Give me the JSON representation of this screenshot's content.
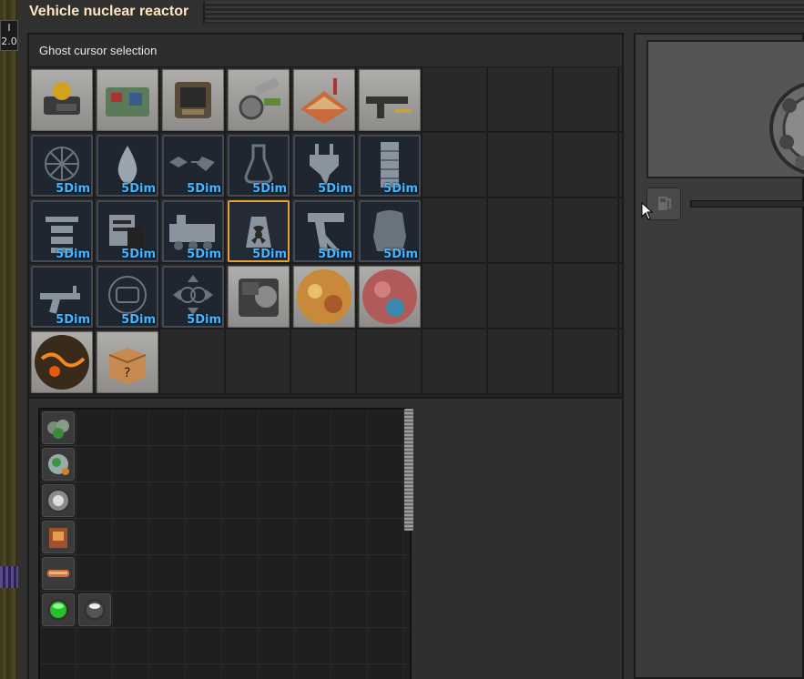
{
  "window": {
    "title": "Vehicle nuclear reactor"
  },
  "hud": {
    "line1": "I",
    "line2": "2.0"
  },
  "ghost_panel": {
    "header": "Ghost cursor selection"
  },
  "tabs": [
    {
      "id": "logistics",
      "icon": "logistics-icon",
      "badge": ""
    },
    {
      "id": "production",
      "icon": "production-icon",
      "badge": ""
    },
    {
      "id": "intermediate",
      "icon": "intermediate-products-icon",
      "badge": ""
    },
    {
      "id": "combat-materials",
      "icon": "gears-icon",
      "badge": ""
    },
    {
      "id": "space",
      "icon": "space-platform-icon",
      "badge": ""
    },
    {
      "id": "combat",
      "icon": "submachine-gun-icon",
      "badge": ""
    },
    {
      "id": "5dim-mining",
      "icon": "mining-drill-icon",
      "badge": "5Dim"
    },
    {
      "id": "5dim-fluids",
      "icon": "fluid-drop-icon",
      "badge": "5Dim"
    },
    {
      "id": "5dim-transport",
      "icon": "transport-arrow-icon",
      "badge": "5Dim"
    },
    {
      "id": "5dim-science",
      "icon": "flask-icon",
      "badge": "5Dim"
    },
    {
      "id": "5dim-energy",
      "icon": "power-plug-icon",
      "badge": "5Dim"
    },
    {
      "id": "5dim-walls",
      "icon": "wall-icon",
      "badge": "5Dim"
    },
    {
      "id": "5dim-robots",
      "icon": "drone-icon",
      "badge": "5Dim"
    },
    {
      "id": "5dim-storage",
      "icon": "storage-tower-icon",
      "badge": "5Dim"
    },
    {
      "id": "5dim-trains",
      "icon": "locomotive-icon",
      "badge": "5Dim"
    },
    {
      "id": "5dim-nuclear",
      "icon": "nuclear-icon",
      "badge": "5Dim",
      "selected": true
    },
    {
      "id": "5dim-turrets",
      "icon": "turret-icon",
      "badge": "5Dim"
    },
    {
      "id": "5dim-armor",
      "icon": "armor-icon",
      "badge": "5Dim"
    },
    {
      "id": "5dim-weapons",
      "icon": "rifle-icon",
      "badge": "5Dim"
    },
    {
      "id": "5dim-engine",
      "icon": "engine-icon",
      "badge": "5Dim"
    },
    {
      "id": "5dim-modules",
      "icon": "module-icon",
      "badge": "5Dim"
    },
    {
      "id": "vehicles",
      "icon": "vehicle-equipment-icon",
      "badge": ""
    },
    {
      "id": "planet-vulcanus",
      "icon": "planet-vulcanus-icon",
      "badge": ""
    },
    {
      "id": "planet-gleba",
      "icon": "planet-gleba-icon",
      "badge": ""
    },
    {
      "id": "planet-lava",
      "icon": "planet-lava-icon",
      "badge": ""
    },
    {
      "id": "unsorted",
      "icon": "unsorted-box-icon",
      "badge": ""
    }
  ],
  "items": [
    {
      "id": "reactor-mk1",
      "icon": "reactor-green-icon"
    },
    {
      "id": "reactor-mk2",
      "icon": "reactor-orb-icon"
    },
    {
      "id": "reactor-mk3",
      "icon": "reactor-steel-icon"
    },
    {
      "id": "reactor-mk4",
      "icon": "reactor-red-icon"
    },
    {
      "id": "reactor-mk5",
      "icon": "reactor-pipe-icon"
    },
    {
      "id": "fuel-cell-green",
      "icon": "fuel-cell-green-icon"
    },
    {
      "id": "fuel-cell-used",
      "icon": "fuel-cell-used-icon"
    }
  ],
  "colors": {
    "title": "#ffe6c0",
    "badge": "#43b8ff",
    "selected_border": "#e3a13b"
  }
}
